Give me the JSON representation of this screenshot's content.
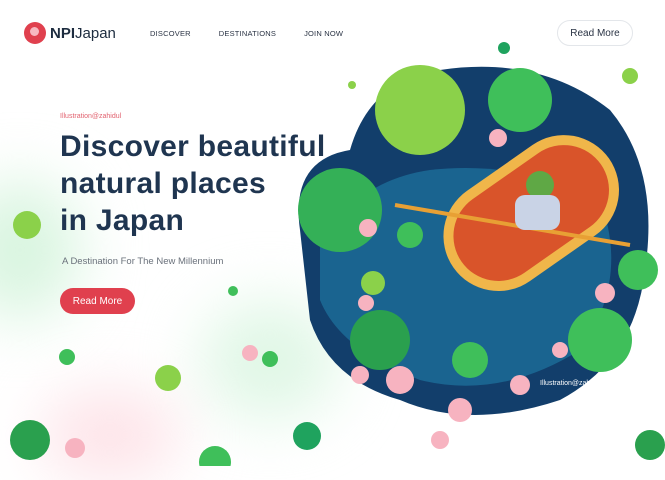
{
  "brand": {
    "bold": "NPI",
    "light": "Japan"
  },
  "nav": [
    "DISCOVER",
    "DESTINATIONS",
    "JOIN NOW"
  ],
  "header_button": "Read More",
  "hero": {
    "credit": "Illustration@zahidul",
    "title_lines": [
      "Discover beautiful",
      "natural places",
      "in Japan"
    ],
    "subtitle": "A Destination For The New Millennium",
    "button": "Read More"
  },
  "illustration_credit": "Illustration@zahidul",
  "colors": {
    "accent": "#e0404e",
    "heading": "#1f3550",
    "pond": "#123e6b",
    "leaf": "#3fbf5a",
    "boat": "#d9542a"
  }
}
